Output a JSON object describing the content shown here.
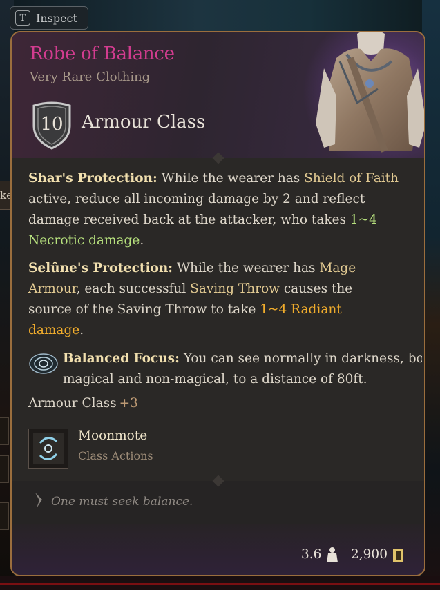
{
  "inspect": {
    "key": "T",
    "label": "Inspect"
  },
  "left_tab": {
    "partial_text": "ke"
  },
  "item": {
    "name": "Robe of Balance",
    "rarity": "Very Rare Clothing",
    "armour_class_value": "10",
    "armour_class_label": "Armour Class",
    "name_color": "#d23c8f"
  },
  "shars_protection": {
    "title": "Shar's Protection:",
    "line1": "While the wearer has ",
    "shield_of_faith": "Shield of Faith",
    "line2": "active, reduce all incoming damage by 2 and reflect",
    "line3": "damage received back at the attacker, who takes ",
    "damage_roll": "1~4",
    "damage_type": "Necrotic damage",
    "end": "."
  },
  "selunes_protection": {
    "title": "Selûne's Protection:",
    "line1": "While the wearer has ",
    "mage": "Mage",
    "armour": "Armour",
    "line2": ", each successful ",
    "saving_throw": "Saving Throw",
    "line2b": " causes the",
    "line3": "source of the Saving Throw to take ",
    "damage_roll": "1~4 Radiant",
    "damage_word": "damage",
    "end": "."
  },
  "balanced_focus": {
    "title": "Balanced Focus:",
    "line1": "You can see normally in darkness, both",
    "line2": "magical and non-magical, to a distance of 80ft."
  },
  "armour_bonus": {
    "label": "Armour Class",
    "value": "+3"
  },
  "action": {
    "name": "Moonmote",
    "category": "Class Actions"
  },
  "flavor": {
    "text": "One must seek balance."
  },
  "footer": {
    "weight": "3.6",
    "price": "2,900",
    "weight_icon": "weight-icon",
    "coin_icon": "gold-coin-icon"
  }
}
